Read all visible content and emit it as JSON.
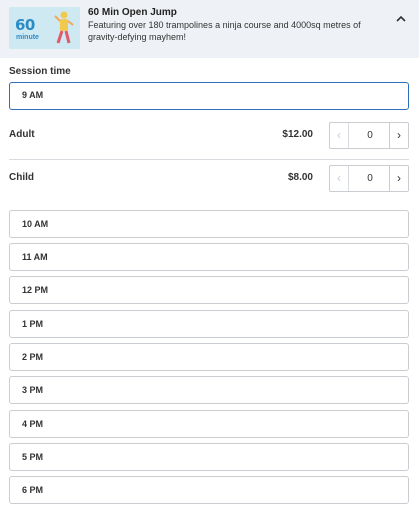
{
  "product": {
    "thumbnail_number": "60",
    "thumbnail_unit": "minute",
    "title": "60 Min Open Jump",
    "description": "Featuring over 180 trampolines a ninja course and 4000sq metres of gravity-defying mayhem!",
    "collapse_icon": "chevron-up-icon"
  },
  "session": {
    "label": "Session time",
    "selected": "9 AM"
  },
  "tickets": [
    {
      "name": "Adult",
      "price": "$12.00",
      "quantity": "0",
      "dec": "‹",
      "inc": "›"
    },
    {
      "name": "Child",
      "price": "$8.00",
      "quantity": "0",
      "dec": "‹",
      "inc": "›"
    }
  ],
  "time_options": [
    "10 AM",
    "11 AM",
    "12 PM",
    "1 PM",
    "2 PM",
    "3 PM",
    "4 PM",
    "5 PM",
    "6 PM"
  ],
  "colors": {
    "accent": "#2e6fb8",
    "header_bg": "#eef1f5",
    "panel_bg": "#ffffff",
    "border": "#c9cdd2"
  }
}
